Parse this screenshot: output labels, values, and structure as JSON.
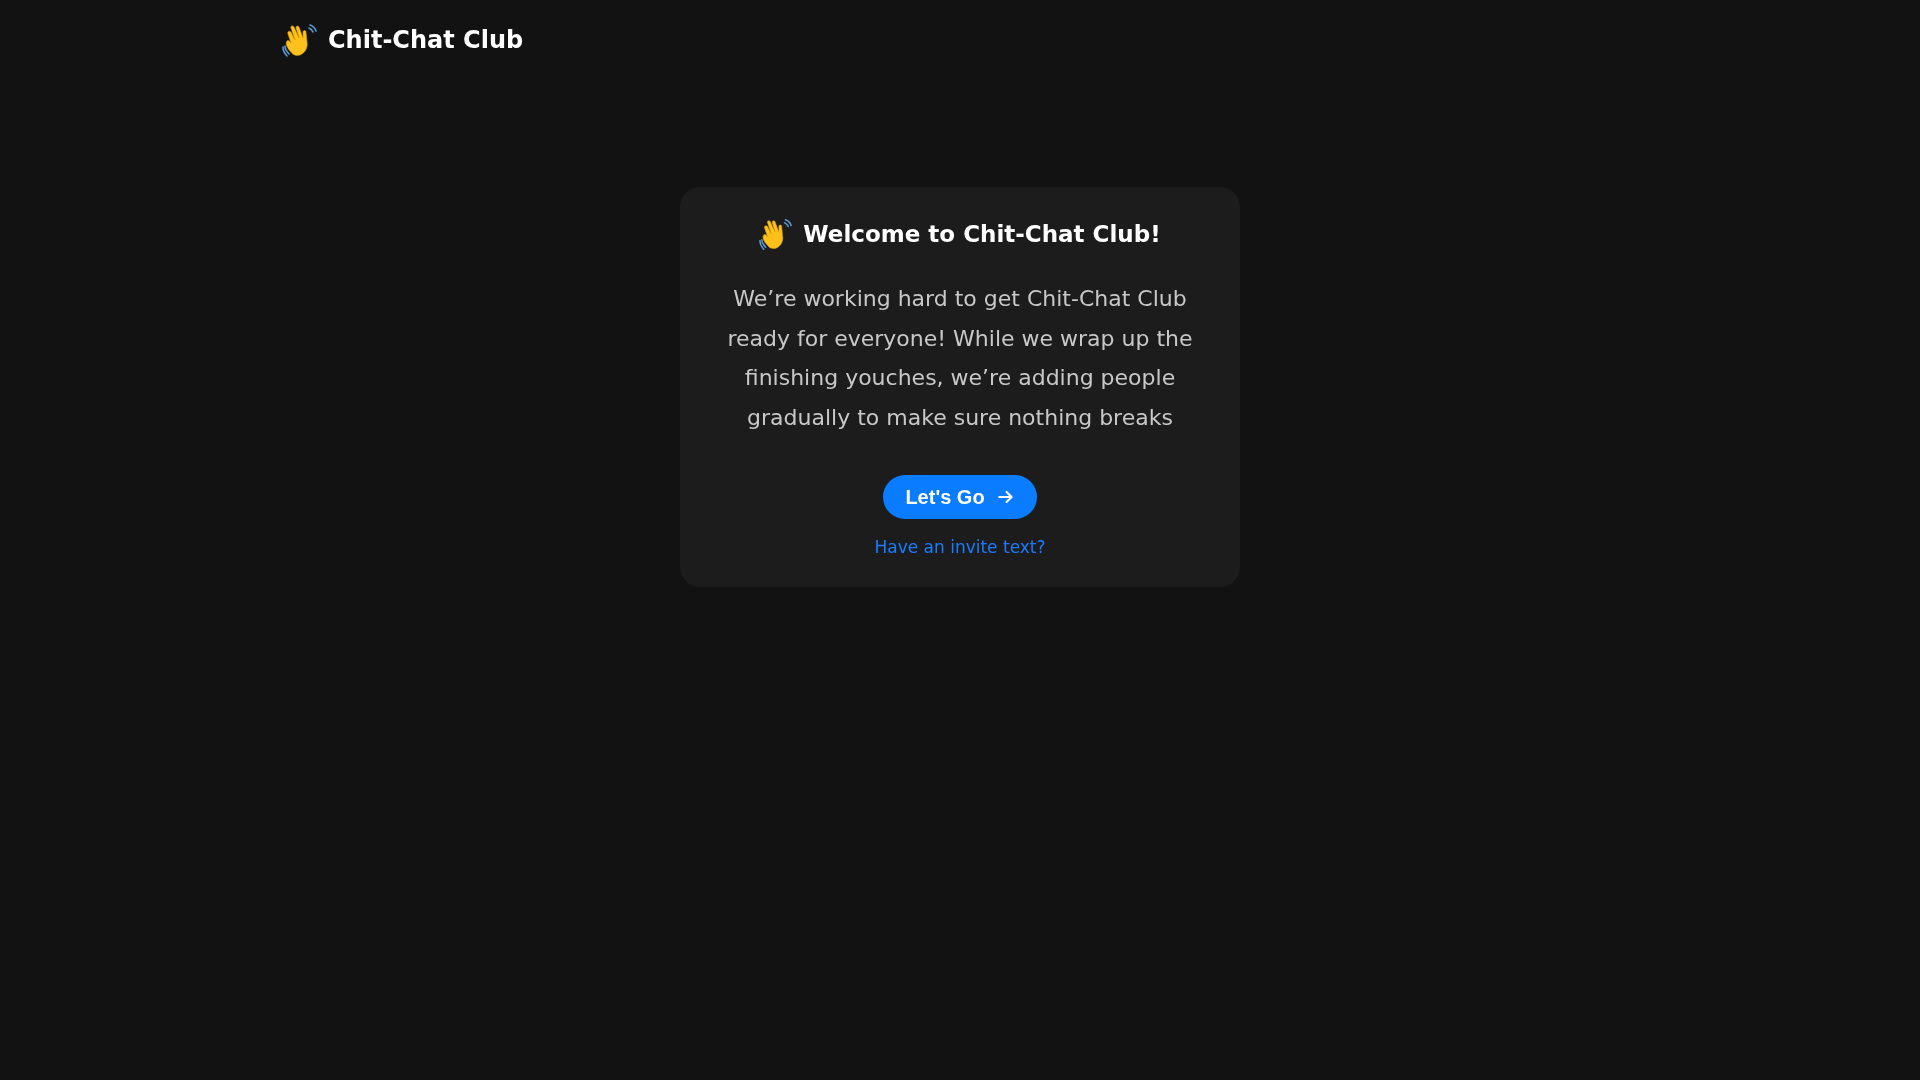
{
  "header": {
    "brand": "Chit-Chat Club"
  },
  "card": {
    "title": "Welcome to Chit-Chat Club!",
    "message": "We’re working hard to get Chit-Chat Club ready for everyone! While we wrap up the finishing youches, we’re adding people gradually to make sure nothing breaks",
    "button": "Let's Go",
    "link": "Have an invite text?"
  }
}
